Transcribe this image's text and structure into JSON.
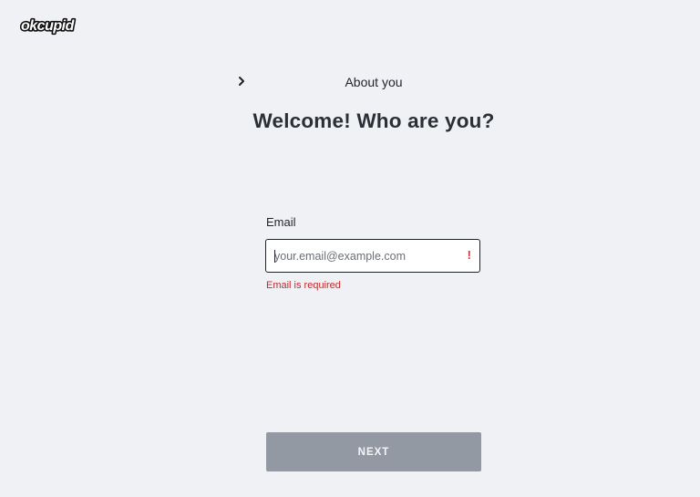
{
  "brand": {
    "logo_text": "okcupid",
    "logo_icon": "okcupid-wordmark"
  },
  "header": {
    "back_icon": "chevron-right-icon",
    "step_title": "About you"
  },
  "main": {
    "title": "Welcome! Who are you?"
  },
  "form": {
    "email_label": "Email",
    "email_value": "",
    "email_placeholder": "your.email@example.com",
    "error_mark": "!",
    "error_message": "Email is required"
  },
  "actions": {
    "next_label": "NEXT"
  },
  "colors": {
    "background": "#f0f1f5",
    "text": "#1f2228",
    "error": "#c0292f",
    "button_disabled": "#9399a3"
  }
}
